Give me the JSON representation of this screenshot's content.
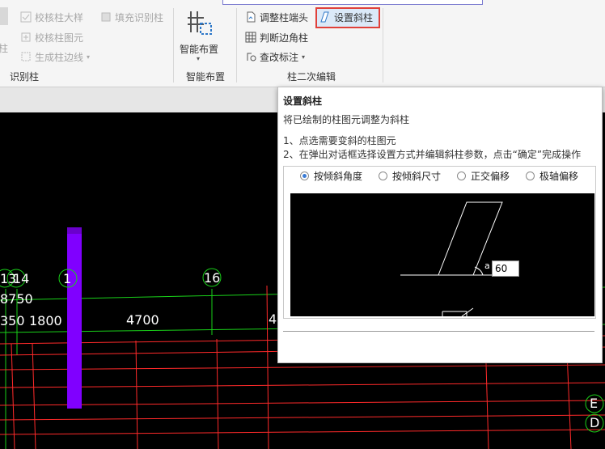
{
  "ribbon": {
    "col1": {
      "items": [
        "校核柱大样",
        "校核柱图元",
        "生成柱边线"
      ],
      "fill_label": "填充识别柱",
      "left_cut_1": "别柱",
      "left_cut_2": "柱",
      "group_label": "识别柱"
    },
    "smart_layout": {
      "button_label": "智能布置",
      "group_label": "智能布置"
    },
    "col_edit": {
      "items": [
        "调整柱端头",
        "判断边角柱",
        "查改标注"
      ],
      "highlight_label": "设置斜柱",
      "group_label": "柱二次编辑"
    }
  },
  "canvas": {
    "axis_bubbles": [
      "13",
      "14",
      "1",
      "16"
    ],
    "dims_top": [
      "8750"
    ],
    "dims": [
      "350",
      "1800",
      "4700",
      "4"
    ],
    "right_bubbles": [
      "E",
      "D"
    ]
  },
  "popup": {
    "title": "设置斜柱",
    "description": "将已绘制的柱图元调整为斜柱",
    "steps": [
      "1、点选需要变斜的柱图元",
      "2、在弹出对话框选择设置方式并编辑斜柱参数，点击“确定”完成操作"
    ],
    "options": [
      "按倾斜角度",
      "按倾斜尺寸",
      "正交偏移",
      "极轴偏移"
    ],
    "selected_option": "按倾斜角度",
    "preview": {
      "angle_symbol": "a",
      "angle_value": "60"
    }
  },
  "colors": {
    "highlight_border": "#e0403a",
    "column": "#8000ff",
    "grid_red": "#ff2a2a",
    "grid_green": "#19d019"
  }
}
